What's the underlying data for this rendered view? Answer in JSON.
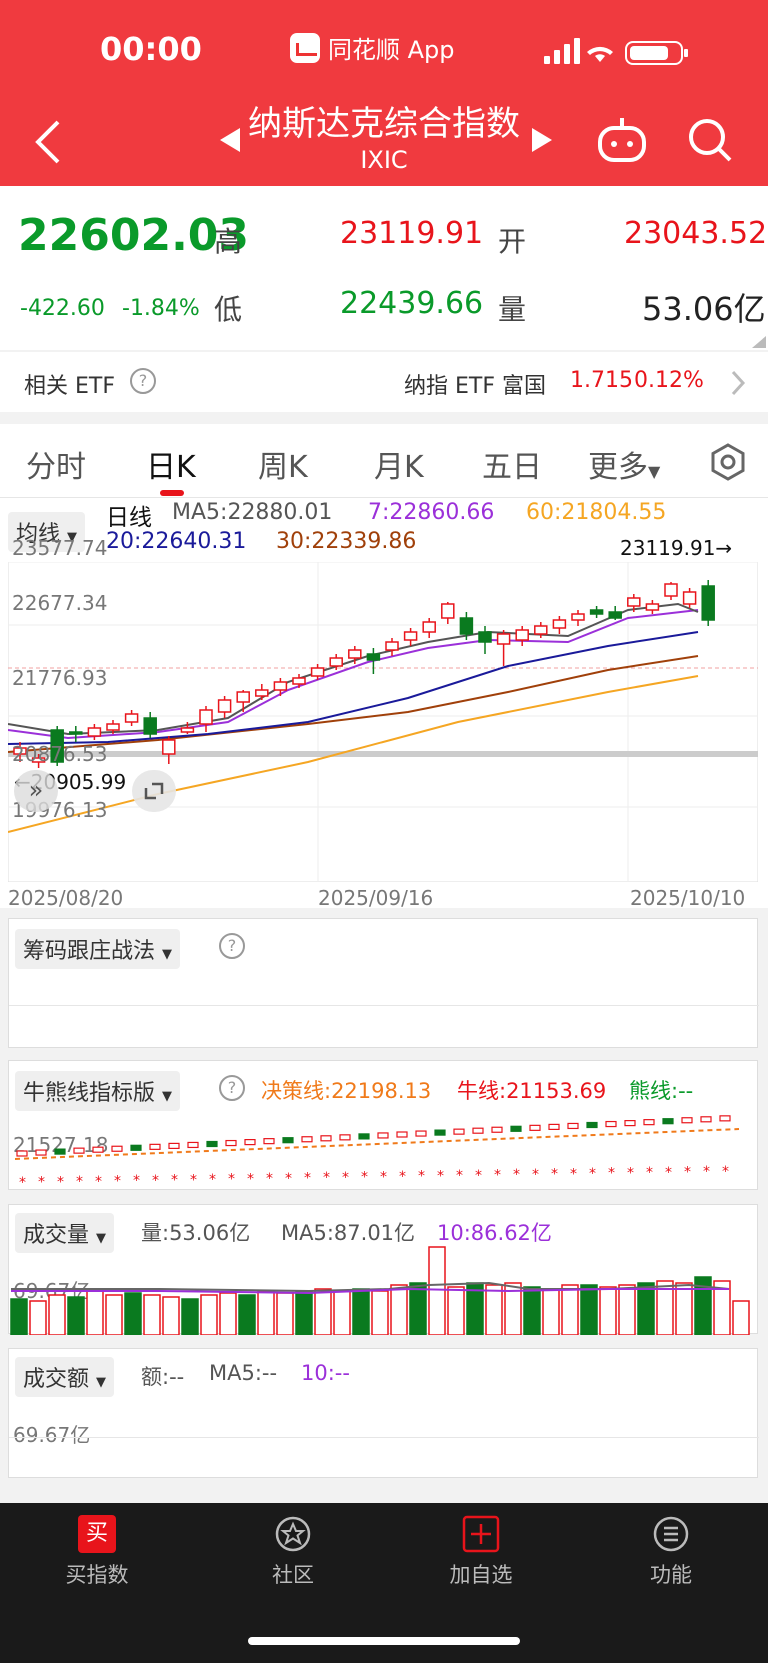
{
  "status": {
    "time": "00:00",
    "app_name": "同花顺 App"
  },
  "header": {
    "title": "纳斯达克综合指数",
    "subtitle": "IXIC"
  },
  "quote": {
    "price": "22602.03",
    "change": "-422.60",
    "change_pct": "-1.84%",
    "high_label": "高",
    "high": "23119.91",
    "open_label": "开",
    "open": "23043.52",
    "low_label": "低",
    "low": "22439.66",
    "volume_label": "量",
    "volume": "53.06亿"
  },
  "etf": {
    "label": "相关 ETF",
    "name": "纳指 ETF 富国",
    "price": "1.715",
    "pct": "0.12%"
  },
  "tabs": [
    "分时",
    "日K",
    "周K",
    "月K",
    "五日",
    "更多"
  ],
  "ma": {
    "selector": "均线",
    "kind": "日线",
    "ma5": "MA5:22880.01",
    "ma7": "7:22860.66",
    "ma60": "60:21804.55",
    "ma20": "20:22640.31",
    "ma30": "30:22339.86"
  },
  "kline": {
    "y_labels": [
      "23577.74",
      "22677.34",
      "21776.93",
      "20876.53",
      "19976.13"
    ],
    "high_mark": "23119.91→",
    "low_mark": "←20905.99",
    "x_labels": [
      "2025/08/20",
      "2025/09/16",
      "2025/10/10"
    ]
  },
  "chip": {
    "label": "筹码跟庄战法"
  },
  "bull": {
    "label": "牛熊线指标版",
    "decision": "决策线:22198.13",
    "bull": "牛线:21153.69",
    "bear": "熊线:--",
    "y_label": "21527.18"
  },
  "vol": {
    "label": "成交量",
    "amount": "量:53.06亿",
    "ma5": "MA5:87.01亿",
    "ma10": "10:86.62亿",
    "y_label": "69.67亿"
  },
  "turnover": {
    "label": "成交额",
    "amount": "额:--",
    "ma5": "MA5:--",
    "ma10": "10:--",
    "y_label": "69.67亿"
  },
  "nav": [
    "买指数",
    "社区",
    "加自选",
    "功能"
  ],
  "colors": {
    "up": "#e8141b",
    "down": "#0a7a1f",
    "ma5": "#555555",
    "ma7": "#9b30d9",
    "ma20": "#1a1a9a",
    "ma30": "#a0400a",
    "ma60": "#f5a623"
  },
  "chart_data": {
    "type": "candlestick",
    "x_range": [
      "2025/08/20",
      "2025/10/10"
    ],
    "ylim": [
      19976.13,
      23577.74
    ],
    "close_last": 22602.03,
    "high_marked": 23119.91,
    "low_marked": 20905.99
  }
}
